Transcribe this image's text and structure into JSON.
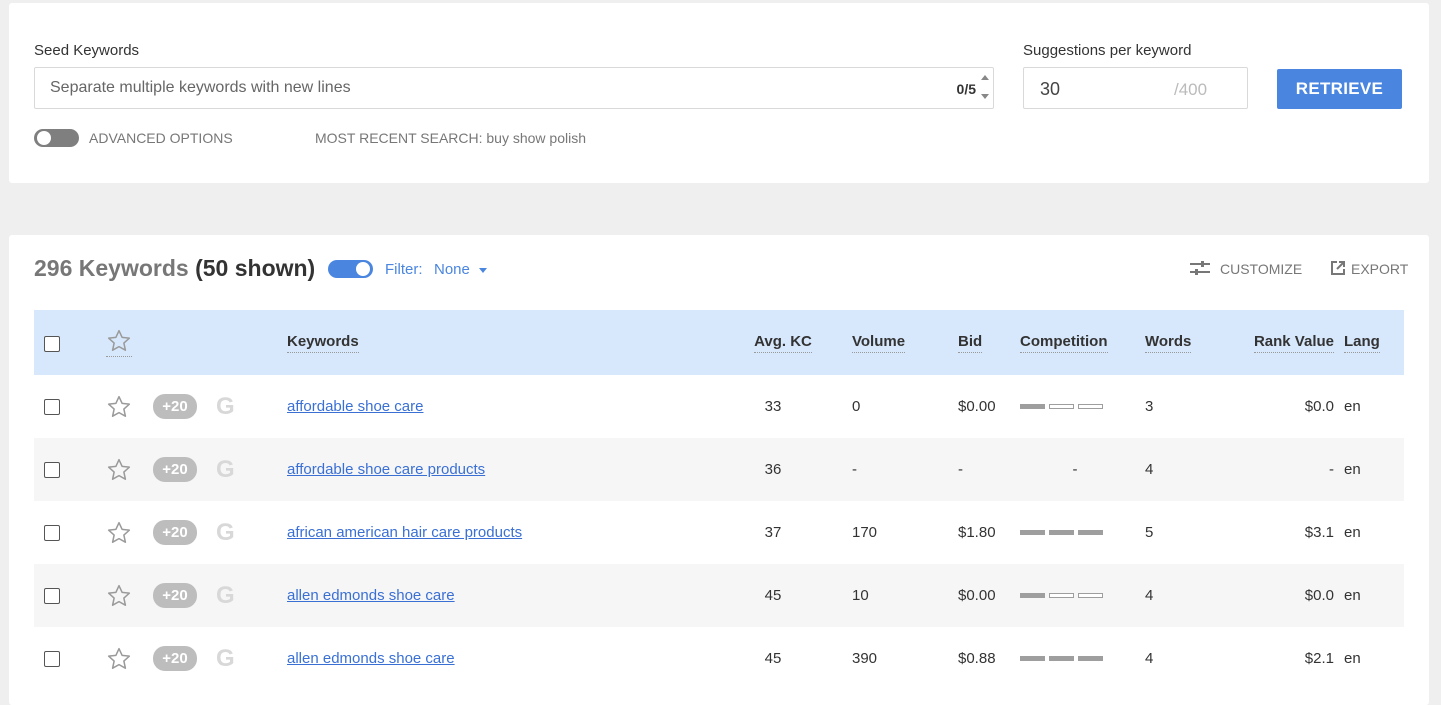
{
  "seed": {
    "label": "Seed Keywords",
    "placeholder": "Separate multiple keywords with new lines",
    "counter": "0/5"
  },
  "suggestions": {
    "label": "Suggestions per keyword",
    "value": "30",
    "max": "/400"
  },
  "retrieve_label": "RETRIEVE",
  "advanced_label": "ADVANCED OPTIONS",
  "advanced_on": false,
  "recent_search": "MOST RECENT SEARCH: buy show polish",
  "results": {
    "count_text": "296 Keywords",
    "shown_text": "(50 shown)",
    "shown_toggle_on": true,
    "filter_label": "Filter:",
    "filter_value": "None",
    "customize_label": "CUSTOMIZE",
    "export_label": "EXPORT"
  },
  "columns": {
    "keywords": "Keywords",
    "avg_kc": "Avg. KC",
    "volume": "Volume",
    "bid": "Bid",
    "competition": "Competition",
    "words": "Words",
    "rank_value": "Rank Value",
    "lang": "Lang"
  },
  "plus_label": "+20",
  "google_glyph": "G",
  "rows": [
    {
      "keyword": "affordable shoe care",
      "avg_kc": "33",
      "volume": "0",
      "bid": "$0.00",
      "competition": 1,
      "competition_text": "",
      "words": "3",
      "rank_value": "$0.0",
      "lang": "en"
    },
    {
      "keyword": "affordable shoe care products",
      "avg_kc": "36",
      "volume": "-",
      "bid": "-",
      "competition": null,
      "competition_text": "-",
      "words": "4",
      "rank_value": "-",
      "lang": "en"
    },
    {
      "keyword": "african american hair care products",
      "avg_kc": "37",
      "volume": "170",
      "bid": "$1.80",
      "competition": 3,
      "competition_text": "",
      "words": "5",
      "rank_value": "$3.1",
      "lang": "en"
    },
    {
      "keyword": "allen edmonds shoe care",
      "avg_kc": "45",
      "volume": "10",
      "bid": "$0.00",
      "competition": 1,
      "competition_text": "",
      "words": "4",
      "rank_value": "$0.0",
      "lang": "en"
    },
    {
      "keyword": "allen edmonds shoe care",
      "avg_kc": "45",
      "volume": "390",
      "bid": "$0.88",
      "competition": 3,
      "competition_text": "",
      "words": "4",
      "rank_value": "$2.1",
      "lang": "en"
    }
  ]
}
